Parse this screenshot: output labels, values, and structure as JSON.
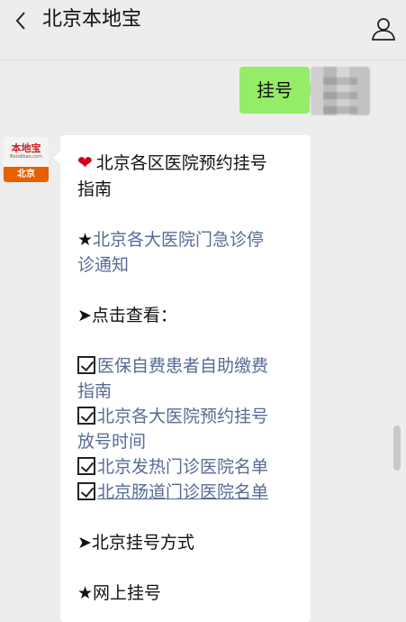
{
  "header": {
    "title": "北京本地宝",
    "back_icon": "chevron-left-icon",
    "profile_icon": "person-icon"
  },
  "outgoing": {
    "text": "挂号"
  },
  "bot_avatar": {
    "logo": "本地宝",
    "sub": "Bendibao.com",
    "bar": "北京"
  },
  "reply": {
    "heading_line1": "北京各区医院预约挂号",
    "heading_line2": "指南",
    "notice_prefix": "★",
    "notice_line1": "北京各大医院门急诊停",
    "notice_line2": "诊通知",
    "click_view": "➤点击查看：",
    "item1_line1": "医保自费患者自助缴费",
    "item1_line2": "指南",
    "item2_line1": "北京各大医院预约挂号",
    "item2_line2": "放号时间",
    "item3": "北京发热门诊医院名单",
    "item4": "北京肠道门诊医院名单",
    "method": "➤北京挂号方式",
    "online": "★网上挂号"
  },
  "colors": {
    "background": "#ededed",
    "outgoing_bubble": "#95ec69",
    "link": "#576b95",
    "brand_bar": "#e65f00"
  }
}
